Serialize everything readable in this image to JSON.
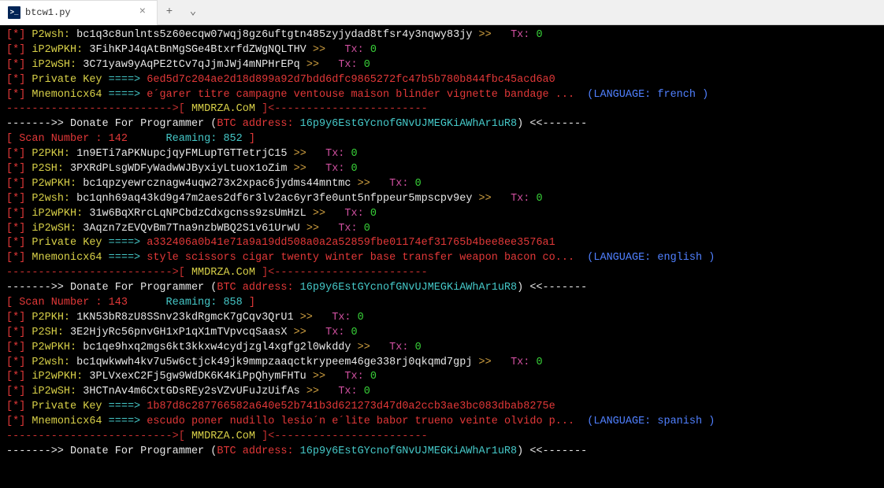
{
  "tab": {
    "title": "btcw1.py",
    "icon_glyph": ">_"
  },
  "site": "MMDRZA.CoM",
  "donate": {
    "prefix": "------->> Donate For Programmer (",
    "btc_label": "BTC address: ",
    "address": "16p9y6EstGYcnofGNvUJMEGKiAWhAr1uR8",
    "suffix": ") <<-------"
  },
  "divider": {
    "left": "-------------------------->[",
    "right": "]<------------------------"
  },
  "labels": {
    "star": "[*]",
    "arrows": ">>",
    "tx": "Tx:",
    "pk_arrow": "====>",
    "lang_prefix": "(LANGUAGE:",
    "lang_suffix": ")",
    "scan_prefix": "[ Scan Number :",
    "ream": "Reaming:",
    "scan_suffix": "]",
    "keys": {
      "p2wsh": "P2wsh:",
      "ip2wpkh": "iP2wPKH:",
      "ip2wsh": "iP2wSH:",
      "private": "Private Key",
      "mnemonic": "Mnemonicx64",
      "p2pkh": "P2PKH:",
      "p2sh": "P2SH:",
      "p2wpkh": "P2wPKH:"
    }
  },
  "blocks": [
    {
      "pre": [
        {
          "k": "p2wsh",
          "addr": "bc1q3c8unlnts5z60ecqw07wqj8gz6uftgtn485zyjydad8tfsr4y3nqwy83jy",
          "tx": "0"
        },
        {
          "k": "ip2wpkh",
          "addr": "3FihKPJ4qAtBnMgSGe4BtxrfdZWgNQLTHV",
          "tx": "0"
        },
        {
          "k": "ip2wsh",
          "addr": "3C71yaw9yAqPE2tCv7qJjmJWj4mNPHrEPq",
          "tx": "0"
        }
      ],
      "private_key": "6ed5d7c204ae2d18d899a92d7bdd6dfc9865272fc47b5b780b844fbc45acd6a0",
      "mnemonic": "e´garer titre campagne ventouse maison blinder vignette bandage ...",
      "language": "french",
      "scan": {
        "num": "142",
        "ream": "852"
      },
      "post": [
        {
          "k": "p2pkh",
          "addr": "1n9ETi7aPKNupcjqyFMLupTGTTetrjC15",
          "tx": "0"
        },
        {
          "k": "p2sh",
          "addr": "3PXRdPLsgWDFyWadwWJByxiyLtuox1oZim",
          "tx": "0"
        },
        {
          "k": "p2wpkh",
          "addr": "bc1qpzyewrcznagw4uqw273x2xpac6jydms44mntmc",
          "tx": "0"
        },
        {
          "k": "p2wsh",
          "addr": "bc1qnh69aq43kd9g47m2aes2df6r3lv2ac6yr3fe0unt5nfppeur5mpscpv9ey",
          "tx": "0"
        },
        {
          "k": "ip2wpkh",
          "addr": "31w6BqXRrcLqNPCbdzCdxgcnss9zsUmHzL",
          "tx": "0"
        },
        {
          "k": "ip2wsh",
          "addr": "3Aqzn7zEVQvBm7Tna9nzbWBQ2S1v61UrwU",
          "tx": "0"
        }
      ]
    },
    {
      "private_key": "a332406a0b41e71a9a19dd508a0a2a52859fbe01174ef31765b4bee8ee3576a1",
      "mnemonic": "style scissors cigar twenty winter base transfer weapon bacon co...",
      "language": "english",
      "scan": {
        "num": "143",
        "ream": "858"
      },
      "post": [
        {
          "k": "p2pkh",
          "addr": "1KN53bR8zU8SSnv23kdRgmcK7gCqv3QrU1",
          "tx": "0"
        },
        {
          "k": "p2sh",
          "addr": "3E2HjyRc56pnvGH1xP1qX1mTVpvcqSaasX",
          "tx": "0"
        },
        {
          "k": "p2wpkh",
          "addr": "bc1qe9hxq2mgs6kt3kkxw4cydjzgl4xgfg2l0wkddy",
          "tx": "0"
        },
        {
          "k": "p2wsh",
          "addr": "bc1qwkwwh4kv7u5w6ctjck49jk9mmpzaaqctkrypeem46ge338rj0qkqmd7gpj",
          "tx": "0"
        },
        {
          "k": "ip2wpkh",
          "addr": "3PLVxexC2Fj5gw9WdDK6K4KiPpQhymFHTu",
          "tx": "0"
        },
        {
          "k": "ip2wsh",
          "addr": "3HCTnAv4m6CxtGDsREy2sVZvUFuJzUifAs",
          "tx": "0"
        }
      ]
    },
    {
      "private_key": "1b87d8c287766582a640e52b741b3d621273d47d0a2ccb3ae3bc083dbab8275e",
      "mnemonic": "escudo poner nudillo lesio´n e´lite babor trueno veinte olvido p...",
      "language": "spanish",
      "last": true
    }
  ]
}
